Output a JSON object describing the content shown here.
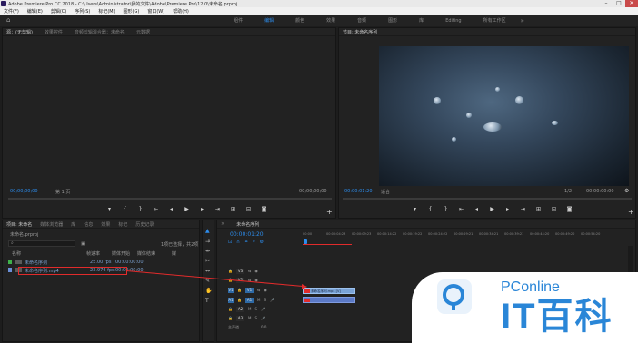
{
  "titlebar": {
    "title": "Adobe Premiere Pro CC 2018 - C:\\Users\\Administrator\\我的文件\\Adobe\\Premiere Pro\\12.0\\未命名.prproj"
  },
  "menubar": {
    "items": [
      "文件(F)",
      "编辑(E)",
      "剪辑(C)",
      "序列(S)",
      "标记(M)",
      "图形(G)",
      "窗口(W)",
      "帮助(H)"
    ]
  },
  "workspaces": {
    "items": [
      "组件",
      "编辑",
      "颜色",
      "效果",
      "音频",
      "图形",
      "库",
      "Editing",
      "所有工作区"
    ],
    "active": "编辑"
  },
  "source_panel": {
    "tabs": [
      "源：(无剪辑)",
      "效果控件",
      "音频剪辑混合器：未命名",
      "元数据"
    ],
    "timecode_left": "00;00;00;00",
    "page": "第 1 页",
    "timecode_right": "00;00;00;00"
  },
  "program_panel": {
    "tabs": [
      "节目: 未命名序列"
    ],
    "timecode_left": "00:00:01:20",
    "fit": "适合",
    "ratio": "1/2",
    "timecode_right": "00:00:00:00"
  },
  "project_panel": {
    "tabs": [
      "项目: 未命名",
      "媒体浏览器",
      "库",
      "信息",
      "效果",
      "标记",
      "历史记录"
    ],
    "filename": "未命名.prproj",
    "selection_info": "1项已选择，共2项",
    "columns": [
      "名称",
      "帧速率",
      "媒体开始",
      "媒体结束",
      "媒"
    ],
    "items": [
      {
        "name": "未命名序列",
        "fps": "25.00 fps",
        "start": "00:00:00:00",
        "end": ""
      },
      {
        "name": "未命名序列.mp4",
        "fps": "23.976 fps",
        "start": "00:00:00:00",
        "end": ""
      }
    ]
  },
  "timeline": {
    "tabs": [
      "未命名序列"
    ],
    "timecode": "00:00:01:20",
    "ruler": [
      "00:00",
      "00:00:04:23",
      "00:00:09:23",
      "00:00:14:22",
      "00:00:19:22",
      "00:00:24:22",
      "00:00:29:21",
      "00:00:34:21",
      "00:00:39:21",
      "00:00:44:20",
      "00:00:49:20",
      "00:00:54:20",
      "00:00:59:1"
    ],
    "tracks": [
      "V3",
      "V2",
      "V1",
      "A1",
      "A2",
      "A3"
    ],
    "master": "主声道",
    "master_value": "0.0",
    "clip_label": "未命名序列.mp4 [V]"
  },
  "logo": {
    "pconline": "PConline",
    "brand": "IT百科"
  },
  "colors": {
    "accent": "#2d8ceb",
    "arrow": "#e12b2b",
    "video_clip": "#7aa3d6",
    "audio_clip": "#5b79c6"
  }
}
